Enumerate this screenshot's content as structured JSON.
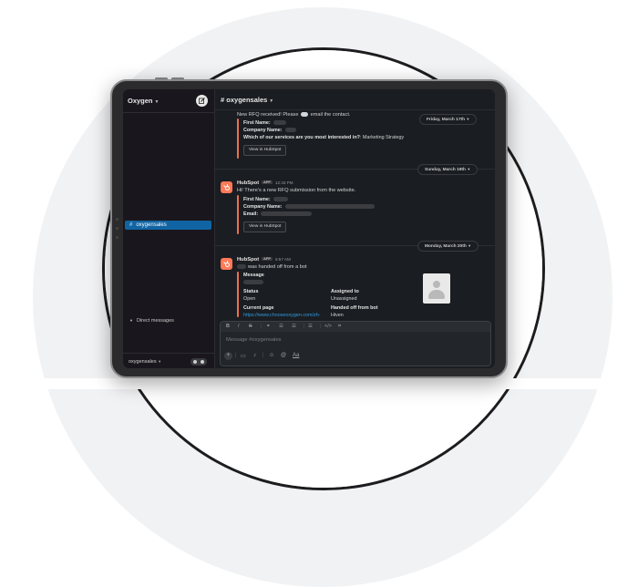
{
  "workspace": {
    "name": "Oxygen",
    "footer_name": "oxygensales"
  },
  "sidebar": {
    "channel_name": "oxygensales",
    "direct_messages_label": "Direct messages"
  },
  "channel_header": {
    "title": "oxygensales"
  },
  "dates": [
    "Friday, March 17th",
    "Sunday, March 19th",
    "Monday, March 20th"
  ],
  "message1": {
    "intro_before": "New RFQ received! Please",
    "intro_after": "email the contact.",
    "first_name_label": "First Name:",
    "company_label": "Company Name:",
    "interest_label": "Which of our services are you most interested in?",
    "interest_value": ": Marketing Strategy",
    "button": "View in HubSpot"
  },
  "message2": {
    "sender": "HubSpot",
    "badge": "APP",
    "time": "12:43 PM",
    "text": "Hi! There's a new RFQ submission from the website.",
    "first_name_label": "First Name:",
    "company_label": "Company Name:",
    "email_label": "Email:",
    "button": "View in HubSpot"
  },
  "message3": {
    "sender": "HubSpot",
    "badge": "APP",
    "time": "8:57 AM",
    "text": "was handed off from a bot",
    "message_label": "Message",
    "status_label": "Status",
    "status_value": "Open",
    "assigned_label": "Assigned to",
    "assigned_value": "Unassigned",
    "current_page_label": "Current page",
    "current_page_value": "https://www.chooseoxygen.com/zh-",
    "handed_off_label": "Handed off from bot",
    "handed_off_value": "Hiven"
  },
  "composer": {
    "placeholder": "Message #oxygensales"
  },
  "colors": {
    "accent": "#e8714e",
    "selected_channel": "#1164a3",
    "link": "#2e9ce0",
    "hubspot": "#ff7a59"
  }
}
